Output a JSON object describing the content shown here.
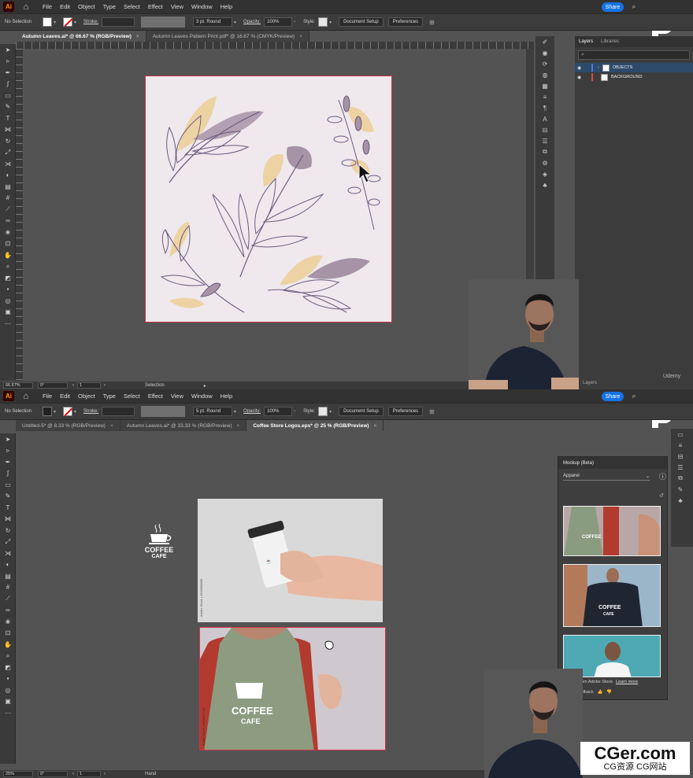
{
  "app": {
    "logo": "Ai",
    "share_label": "Share"
  },
  "menus": [
    "File",
    "Edit",
    "Object",
    "Type",
    "Select",
    "Effect",
    "View",
    "Window",
    "Help"
  ],
  "top_pane": {
    "control": {
      "selection_label": "No Selection",
      "stroke_label": "Stroke:",
      "brush": "3 pt. Round",
      "opacity_label": "Opacity:",
      "opacity_value": "100%",
      "style_label": "Style:",
      "doc_setup": "Document Setup",
      "preferences": "Preferences"
    },
    "tabs": [
      {
        "label": "Autumn Leaves.ai* @ 66.67 % (RGB/Preview)",
        "active": true
      },
      {
        "label": "Autumn Leaves Pattern Print.pdf* @ 16.67 % (CMYK/Preview)",
        "active": false
      }
    ],
    "ruler_labels": [
      "0",
      "100",
      "150",
      "200",
      "250",
      "300",
      "350",
      "400",
      "450",
      "500",
      "550",
      "600",
      "650",
      "700",
      "750",
      "800",
      "850",
      "900",
      "950",
      "1000"
    ],
    "status": {
      "zoom": "66.67%",
      "angle": "0°",
      "artboard": "1",
      "tool": "Selection"
    },
    "layers": {
      "tabs": [
        "Layers",
        "Libraries"
      ],
      "rows": [
        {
          "name": "OBJECTS",
          "selected": true,
          "bar_color": "#4a7bd8"
        },
        {
          "name": "BACKGROUND",
          "selected": false,
          "bar_color": "#d84a4a"
        }
      ],
      "footer": "Layers",
      "udemy": "Udemy"
    },
    "leaf_colors": {
      "purple": "#6a5a7e",
      "purple_fill": "#a693a6",
      "tan": "#edd3a3",
      "artboard": "#efe9ee"
    }
  },
  "bottom_pane": {
    "control": {
      "selection_label": "No Selection",
      "stroke_label": "Stroke:",
      "brush": "5 pt. Round",
      "opacity_label": "Opacity:",
      "opacity_value": "100%",
      "style_label": "Style:",
      "doc_setup": "Document Setup",
      "preferences": "Preferences"
    },
    "tabs": [
      {
        "label": "Untitled-5* @ 8.33 % (RGB/Preview)",
        "active": false
      },
      {
        "label": "Autumn Leaves.ai* @ 33.33 % (RGB/Preview)",
        "active": false
      },
      {
        "label": "Coffee Store Logos.eps* @ 25 % (RGB/Preview)",
        "active": true
      }
    ],
    "status": {
      "zoom": "25%",
      "angle": "0°",
      "artboard": "1",
      "tool": "Hand"
    },
    "logo": {
      "line1": "COFFEE",
      "line2": "CAFE"
    },
    "mockup_panel": {
      "title": "Mockup (Beta)",
      "category": "Apparel",
      "images_label": "Images from Adobe Stock",
      "learn_more": "Learn more",
      "share_feedback": "Share feedback"
    },
    "stock_credit": "Adobe Stock | #500998856",
    "stock_credit2": "Adobe Stock | #604367734"
  },
  "watermark": {
    "line1": "CGer.com",
    "line2": "CG资源 CG网站"
  }
}
